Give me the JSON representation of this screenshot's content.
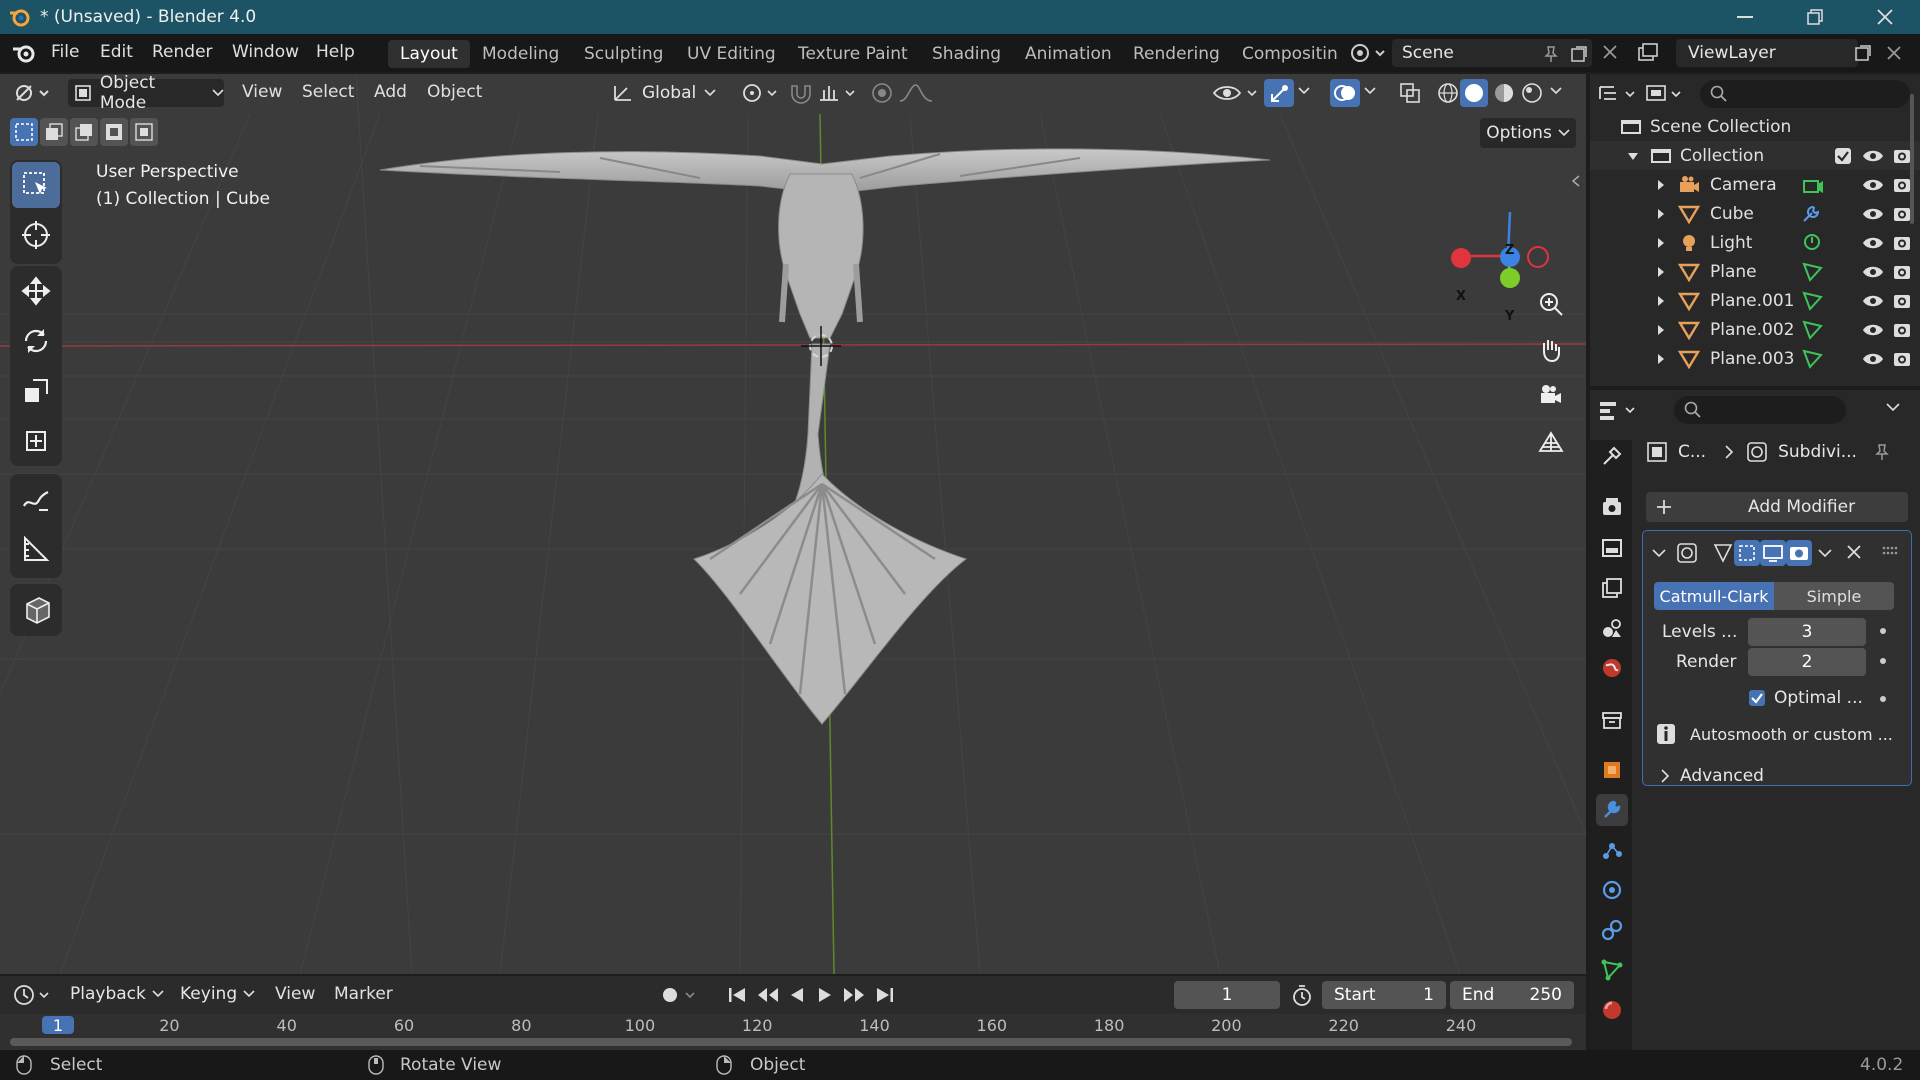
{
  "window": {
    "title": "* (Unsaved) - Blender 4.0"
  },
  "menu": {
    "file": "File",
    "edit": "Edit",
    "render": "Render",
    "window": "Window",
    "help": "Help"
  },
  "workspaces": [
    "Layout",
    "Modeling",
    "Sculpting",
    "UV Editing",
    "Texture Paint",
    "Shading",
    "Animation",
    "Rendering",
    "Compositin"
  ],
  "scene": {
    "name": "Scene",
    "view_layer": "ViewLayer"
  },
  "viewport_header": {
    "mode": "Object Mode",
    "view": "View",
    "select": "Select",
    "add": "Add",
    "object": "Object",
    "orientation": "Global",
    "options": "Options"
  },
  "viewport": {
    "perspective": "User Perspective",
    "context": "(1) Collection | Cube"
  },
  "gizmo": {
    "x": "X",
    "y": "Y",
    "z": "Z"
  },
  "outliner": {
    "root": "Scene Collection",
    "collection": "Collection",
    "items": [
      {
        "name": "Camera",
        "icon": "camera-icon"
      },
      {
        "name": "Cube",
        "icon": "mesh-icon"
      },
      {
        "name": "Light",
        "icon": "light-icon"
      },
      {
        "name": "Plane",
        "icon": "mesh-icon"
      },
      {
        "name": "Plane.001",
        "icon": "mesh-icon"
      },
      {
        "name": "Plane.002",
        "icon": "mesh-icon"
      },
      {
        "name": "Plane.003",
        "icon": "mesh-icon"
      }
    ]
  },
  "properties": {
    "breadcrumb_object": "C...",
    "breadcrumb_modifier": "Subdivi...",
    "add_modifier": "Add Modifier",
    "catmull_clark": "Catmull-Clark",
    "simple": "Simple",
    "levels_label": "Levels ...",
    "levels_value": "3",
    "render_label": "Render",
    "render_value": "2",
    "optimal_label": "Optimal ...",
    "optimal_checked": true,
    "autosmooth": "Autosmooth or custom ...",
    "advanced": "Advanced"
  },
  "timeline": {
    "playback": "Playback",
    "keying": "Keying",
    "view": "View",
    "marker": "Marker",
    "current_frame": "1",
    "start_label": "Start",
    "start_value": "1",
    "end_label": "End",
    "end_value": "250",
    "ruler": [
      "1",
      "20",
      "40",
      "60",
      "80",
      "100",
      "120",
      "140",
      "160",
      "180",
      "200",
      "220",
      "240"
    ]
  },
  "status": {
    "select": "Select",
    "rotate": "Rotate View",
    "object": "Object",
    "version": "4.0.2"
  },
  "colors": {
    "accent": "#4772b3",
    "titlebar": "#1c5365",
    "x_axis": "#e0343f",
    "y_axis": "#7dcc2a",
    "z_axis": "#3c82e0"
  }
}
